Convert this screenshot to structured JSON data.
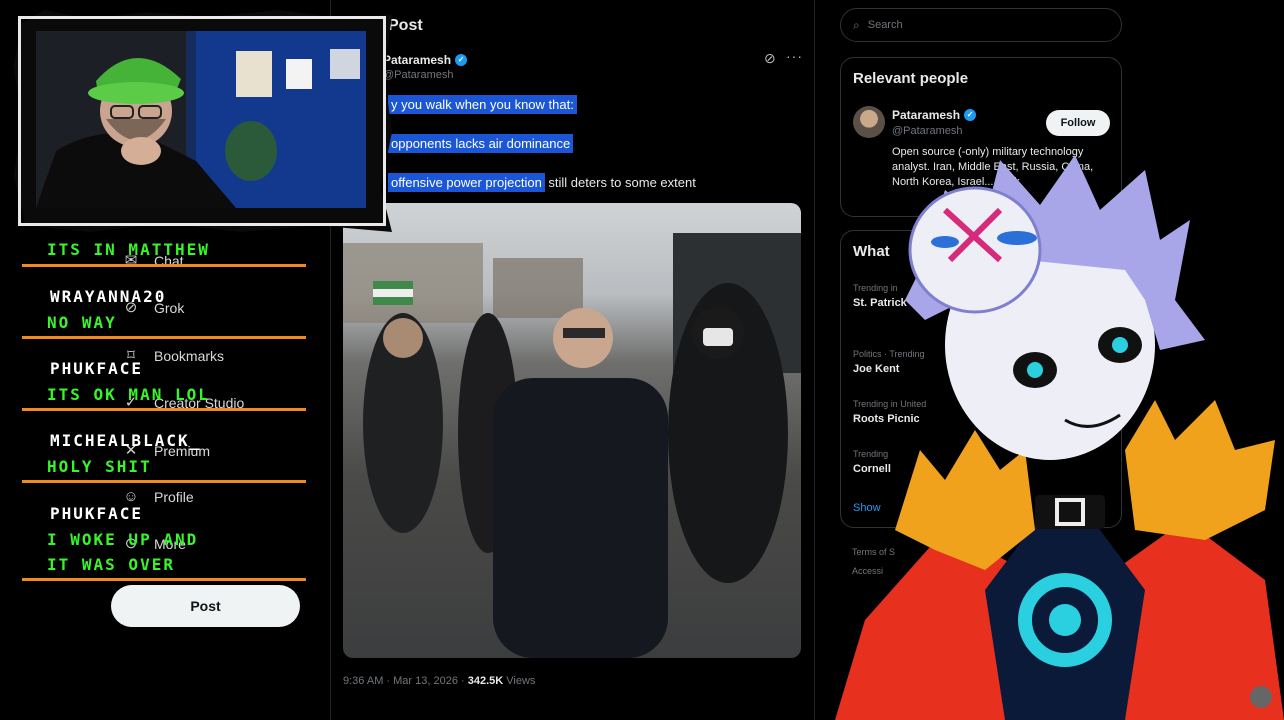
{
  "nav": {
    "items": [
      {
        "label": "Chat",
        "icon": "mail-icon"
      },
      {
        "label": "Grok",
        "icon": "grok-icon"
      },
      {
        "label": "Bookmarks",
        "icon": "bookmark-icon"
      },
      {
        "label": "Creator Studio",
        "icon": "creator-studio-icon"
      },
      {
        "label": "Premium",
        "icon": "x-logo-icon"
      },
      {
        "label": "Profile",
        "icon": "person-icon"
      },
      {
        "label": "More",
        "icon": "more-circle-icon"
      }
    ],
    "post_button": "Post"
  },
  "post": {
    "header": "Post",
    "author_name": "Pataramesh",
    "author_handle": "@Pataramesh",
    "lines": [
      "y you walk when you know that:",
      "opponents lacks air dominance",
      "offensive power projection",
      "still deters to some extent"
    ],
    "meta_time": "9:36 AM · Mar 13, 2026 · ",
    "meta_views_count": "342.5K",
    "meta_views_label": " Views"
  },
  "sidebar": {
    "search_placeholder": "Search",
    "relevant": {
      "title": "Relevant people",
      "name": "Pataramesh",
      "handle": "@Pataramesh",
      "follow": "Follow",
      "bio": "Open source (-only) military technology analyst. Iran, Middle East, Russia, China, North Korea, Israel... work"
    },
    "trends": {
      "title": "What",
      "items": [
        {
          "context": "Trending in",
          "name": "St. Patrick"
        },
        {
          "context": "Politics · Trending",
          "name": "Joe Kent"
        },
        {
          "context": "Trending in United",
          "name": "Roots Picnic"
        },
        {
          "context": "Trending",
          "name": "Cornell"
        }
      ],
      "show_more": "Show"
    },
    "footer_1": "Terms of S",
    "footer_2": "Accessi"
  },
  "chat": {
    "partial": "ITS IN MATTHEW",
    "messages": [
      {
        "user": "WRAYANNA20",
        "text": "NO WAY"
      },
      {
        "user": "PHUKFACE",
        "text": "ITS OK MAN LOL"
      },
      {
        "user": "MICHEALBLACK_",
        "text": "HOLY SHIT"
      },
      {
        "user": "PHUKFACE",
        "text": "I WOKE UP AND"
      }
    ],
    "last_line": "IT WAS OVER"
  },
  "colors": {
    "chat_bar": "#f08a1c",
    "chat_msg": "#38f52a",
    "highlight": "#1a56d6",
    "verified": "#1d9bf0"
  }
}
